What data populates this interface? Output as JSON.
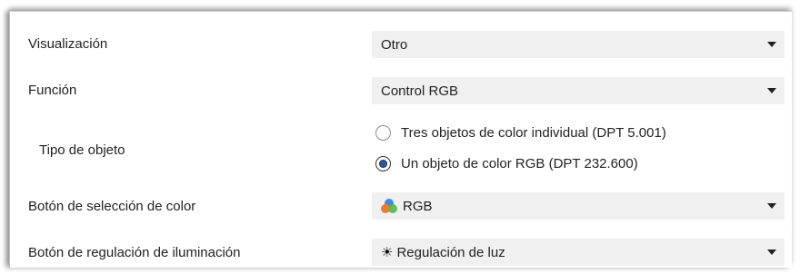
{
  "rows": [
    {
      "label": "Visualización",
      "value": "Otro"
    },
    {
      "label": "Función",
      "value": "Control RGB"
    },
    {
      "label": "Botón de selección de color",
      "value": "RGB",
      "icon": "rgb-color-icon"
    },
    {
      "label": "Botón de regulación de iluminación",
      "value": "Regulación de luz",
      "icon": "brightness-icon"
    }
  ],
  "object_type": {
    "label": "Tipo de objeto",
    "options": [
      {
        "label": "Tres objetos de color individual (DPT 5.001)",
        "selected": false
      },
      {
        "label": "Un objeto de color RGB (DPT 232.600)",
        "selected": true
      }
    ]
  },
  "colors": {
    "dropdown_bg": "#f0f0f0",
    "radio_selected": "#2b5797"
  }
}
